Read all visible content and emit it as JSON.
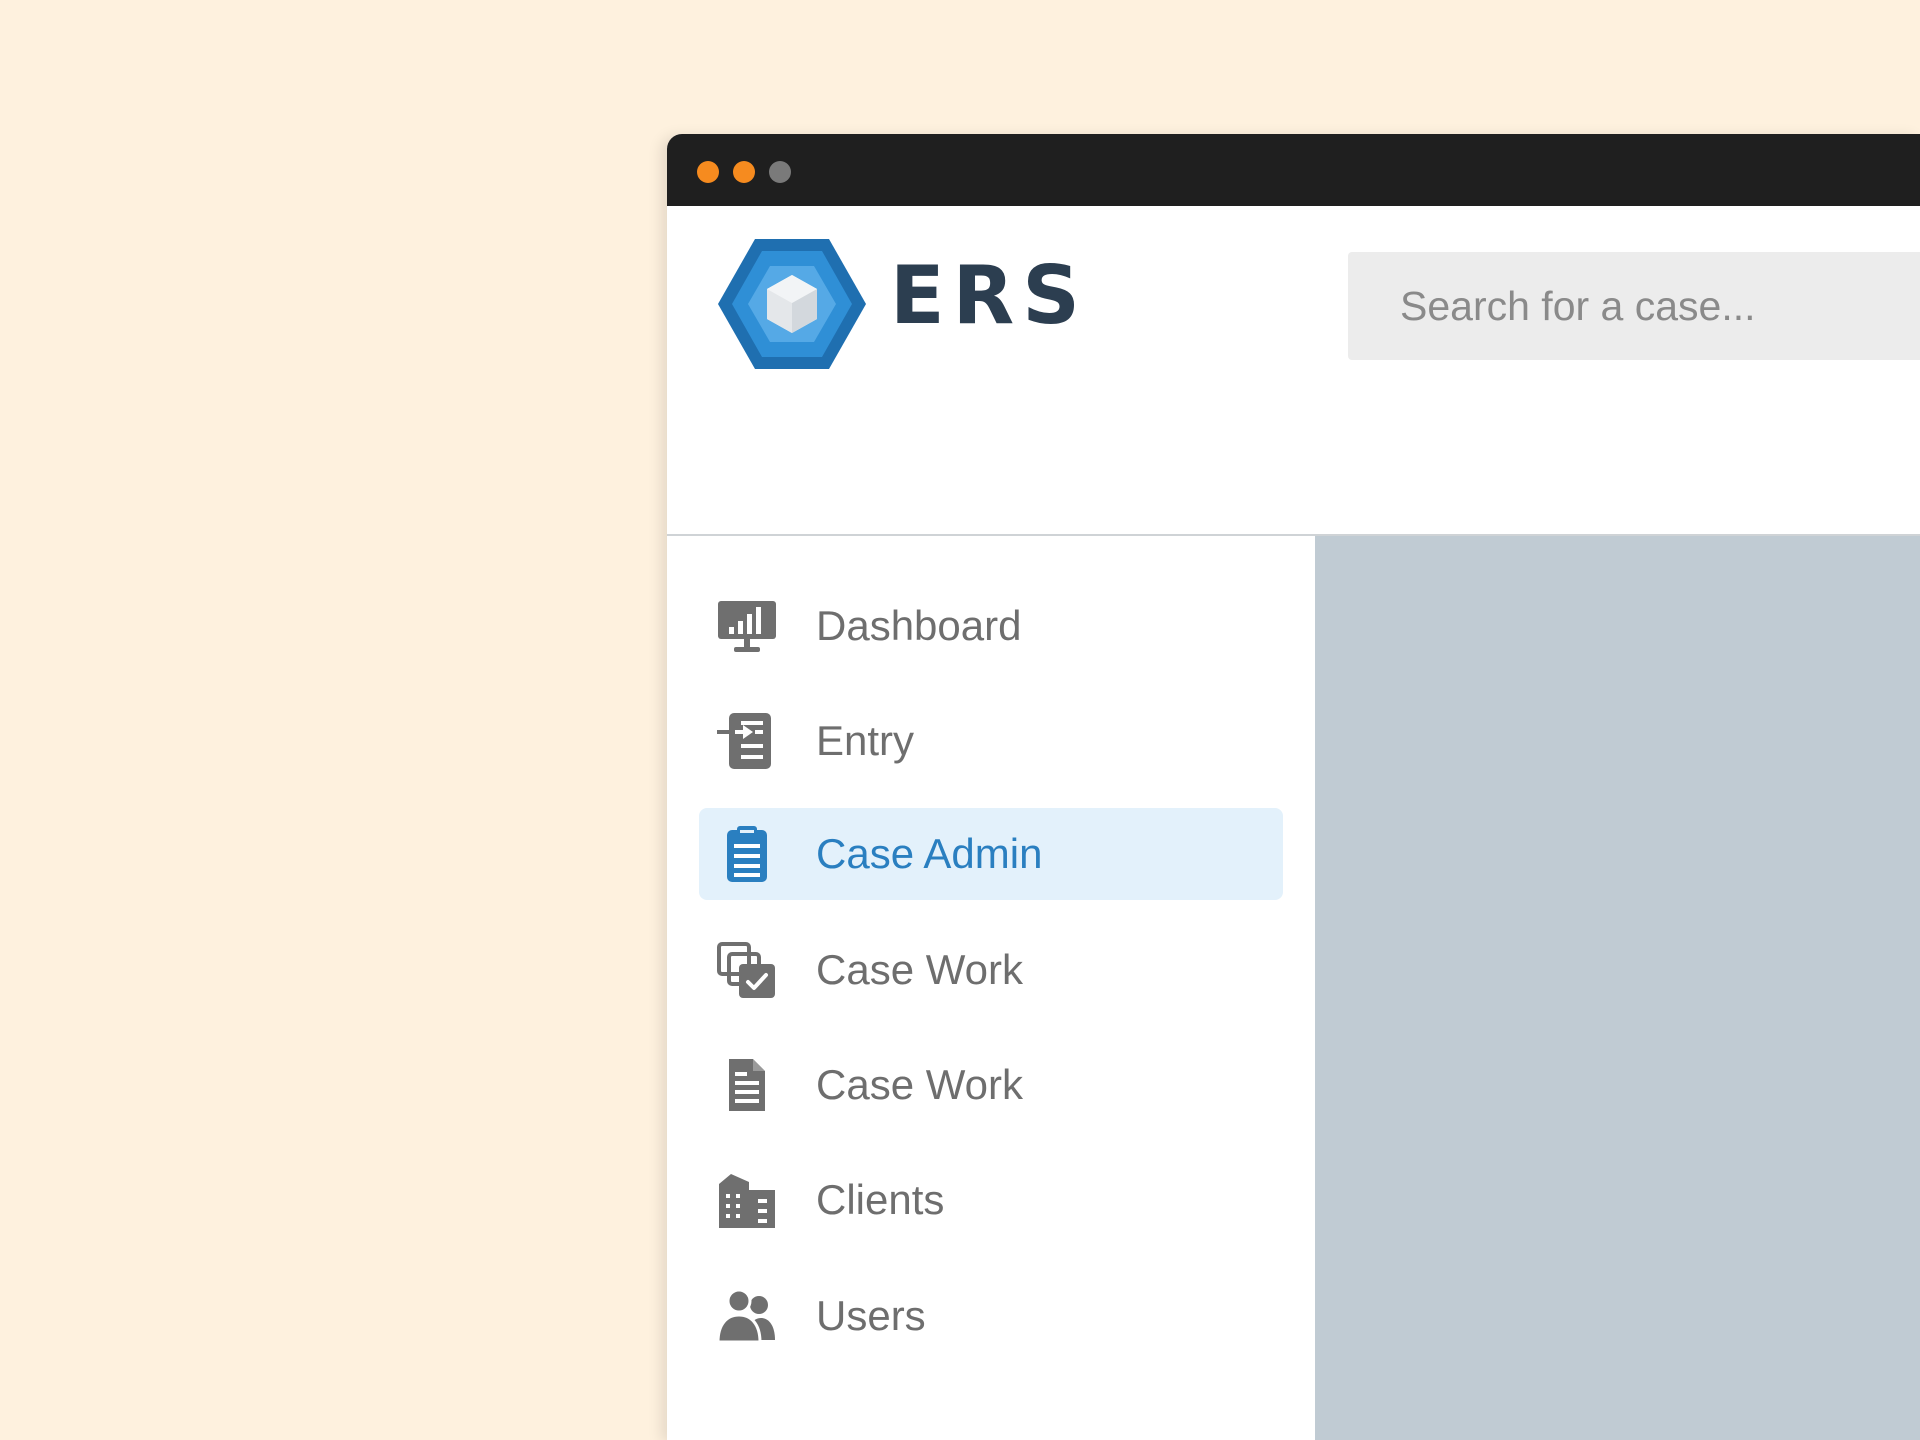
{
  "window": {
    "controls": [
      {
        "name": "close",
        "color": "#f68b1f"
      },
      {
        "name": "minimize",
        "color": "#f68b1f"
      },
      {
        "name": "zoom",
        "color": "#7a7a7a"
      }
    ]
  },
  "header": {
    "brand": "ERS",
    "logo_icon": "hexagon-cube-logo",
    "search": {
      "placeholder": "Search for a case...",
      "value": ""
    }
  },
  "sidebar": {
    "items": [
      {
        "label": "Dashboard",
        "icon": "dashboard-monitor-icon",
        "active": false
      },
      {
        "label": "Entry",
        "icon": "entry-document-icon",
        "active": false
      },
      {
        "label": "Case Admin",
        "icon": "clipboard-icon",
        "active": true
      },
      {
        "label": "Case Work",
        "icon": "copy-check-icon",
        "active": false
      },
      {
        "label": "Case Work",
        "icon": "document-icon",
        "active": false
      },
      {
        "label": "Clients",
        "icon": "building-icon",
        "active": false
      },
      {
        "label": "Users",
        "icon": "users-icon",
        "active": false
      }
    ]
  },
  "colors": {
    "page_background": "#fef1de",
    "titlebar": "#1f1f1f",
    "brand_text": "#2c3e50",
    "accent": "#2a7fc0",
    "active_background": "#e3f1fb",
    "nav_text": "#6e6e6e",
    "icon_gray": "#6f6f6f",
    "content_background": "#c0cbd3",
    "search_background": "#ececec"
  }
}
